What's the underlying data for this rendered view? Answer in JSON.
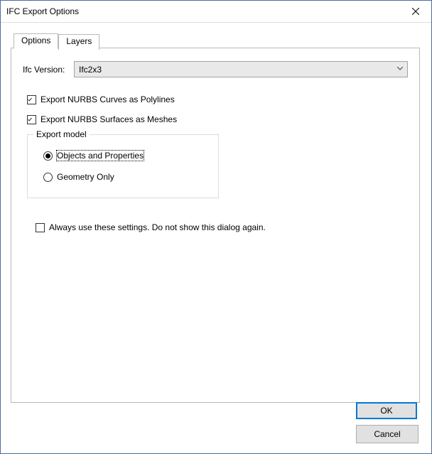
{
  "window": {
    "title": "IFC Export Options"
  },
  "tabs": {
    "options": "Options",
    "layers": "Layers"
  },
  "version": {
    "label": "Ifc Version:",
    "value": "Ifc2x3"
  },
  "checks": {
    "curves": "Export NURBS Curves as Polylines",
    "surfaces": "Export NURBS Surfaces as Meshes",
    "always": "Always use these settings. Do not show this dialog again."
  },
  "group": {
    "legend": "Export model",
    "objects": "Objects and Properties",
    "geometry": "Geometry Only"
  },
  "buttons": {
    "ok": "OK",
    "cancel": "Cancel"
  }
}
